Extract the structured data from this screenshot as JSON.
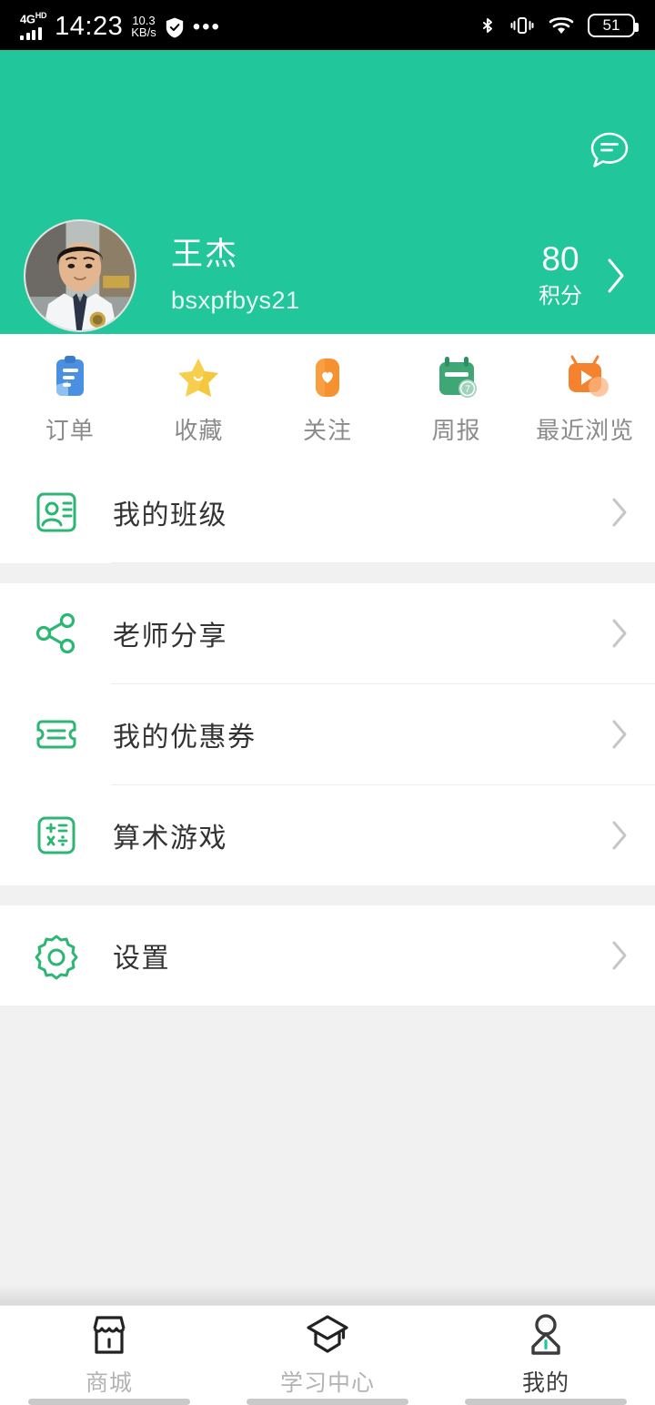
{
  "statusbar": {
    "network_type": "4G",
    "network_suffix": "HD",
    "time": "14:23",
    "speed_value": "10.3",
    "speed_unit": "KB/s",
    "shield_icon": "shield-check-icon",
    "more_icon": "more-dots-icon",
    "bluetooth_icon": "bluetooth-icon",
    "vibrate_icon": "vibrate-icon",
    "wifi_icon": "wifi-icon",
    "battery_level": "51"
  },
  "header": {
    "background_color": "#21c69b",
    "message_icon": "message-bubble-icon",
    "avatar_name": "user-avatar",
    "user_name": "王杰",
    "user_id": "bsxpfbys21",
    "points_value": "80",
    "points_label": "积分",
    "chevron_icon": "chevron-right-icon"
  },
  "quick_actions": [
    {
      "label": "订单",
      "icon": "order-clipboard-icon",
      "color": "#4a90e2"
    },
    {
      "label": "收藏",
      "icon": "favorite-star-icon",
      "color": "#f6cf4e"
    },
    {
      "label": "关注",
      "icon": "follow-heart-icon",
      "color": "#f5912e"
    },
    {
      "label": "周报",
      "icon": "weekly-report-calendar-icon",
      "color": "#3fa675"
    },
    {
      "label": "最近浏览",
      "icon": "recent-browse-tv-icon",
      "color": "#f5822e"
    }
  ],
  "menu_sections": [
    {
      "items": [
        {
          "label": "我的班级",
          "icon": "my-class-card-icon"
        }
      ]
    },
    {
      "items": [
        {
          "label": "老师分享",
          "icon": "share-icon"
        },
        {
          "label": "我的优惠券",
          "icon": "coupon-ticket-icon"
        },
        {
          "label": "算术游戏",
          "icon": "calculator-game-icon"
        }
      ]
    },
    {
      "items": [
        {
          "label": "设置",
          "icon": "settings-gear-icon"
        }
      ]
    }
  ],
  "accent_color": "#2bb673",
  "bottom_nav": [
    {
      "label": "商城",
      "icon": "store-icon",
      "active": false
    },
    {
      "label": "学习中心",
      "icon": "graduation-cap-icon",
      "active": false
    },
    {
      "label": "我的",
      "icon": "person-icon",
      "active": true
    }
  ]
}
